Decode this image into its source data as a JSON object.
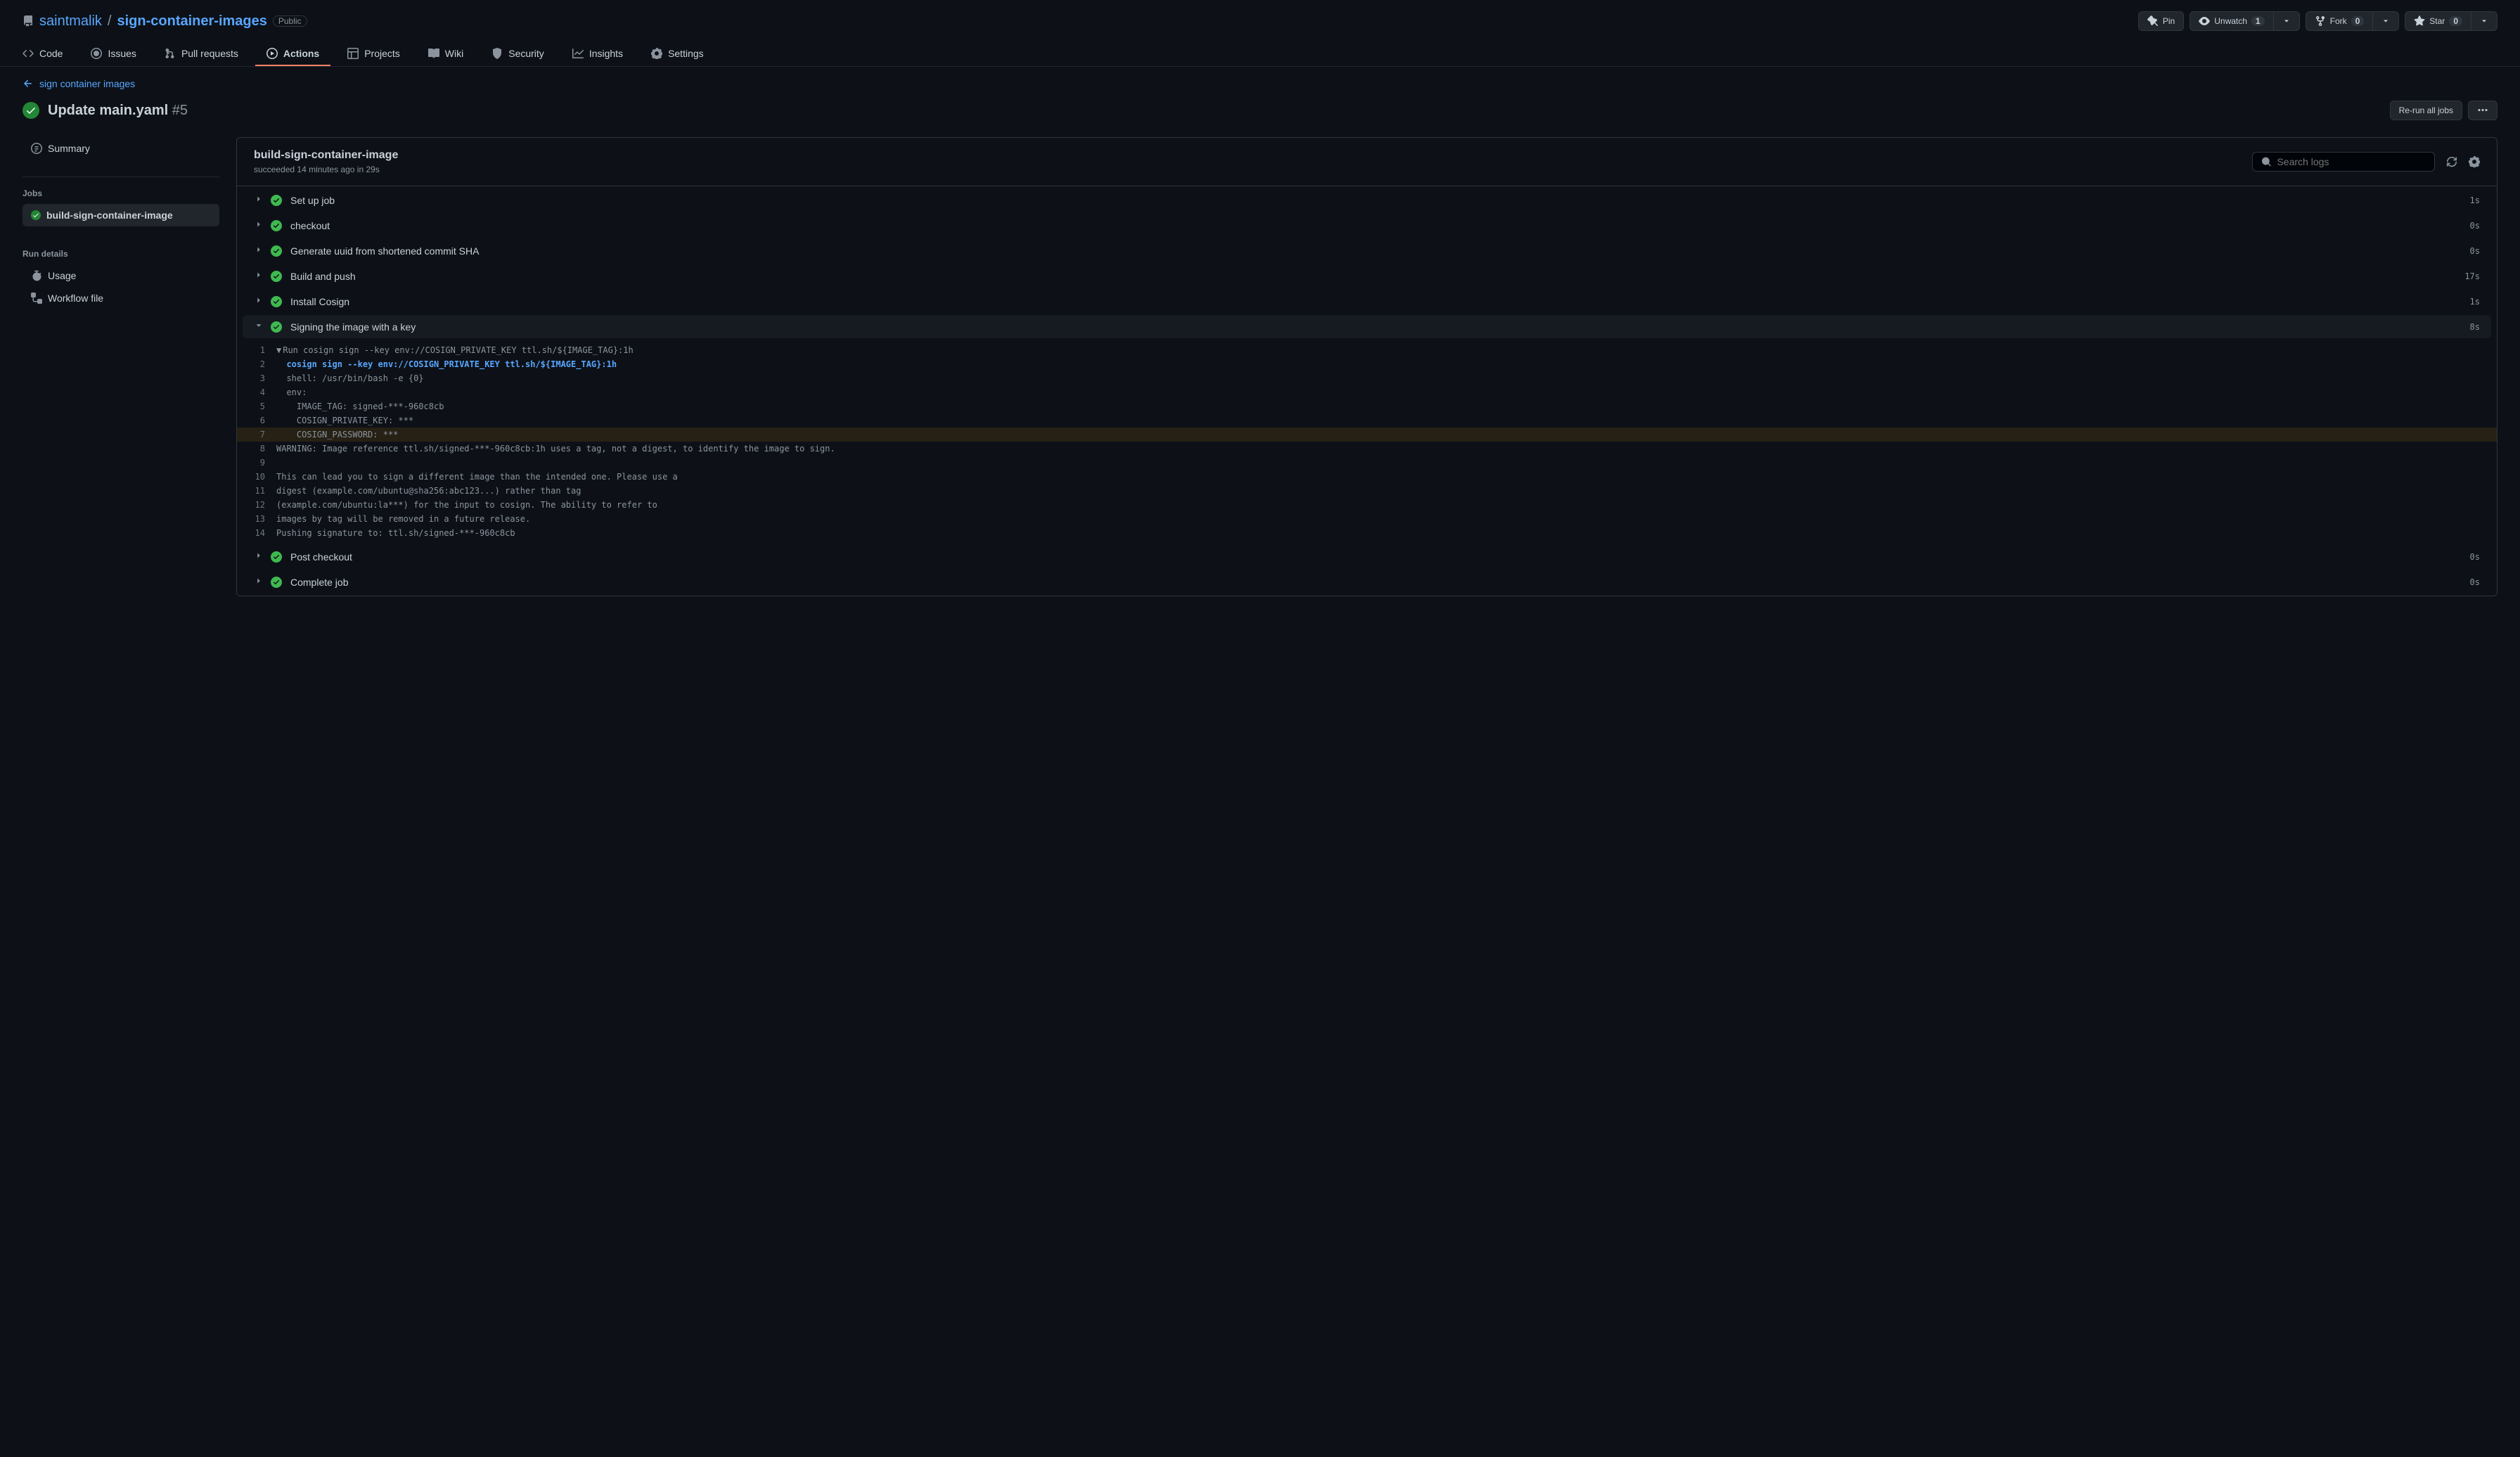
{
  "repo": {
    "owner": "saintmalik",
    "name": "sign-container-images",
    "visibility": "Public"
  },
  "actions": {
    "pin": {
      "label": "Pin"
    },
    "watch": {
      "label": "Unwatch",
      "count": "1"
    },
    "fork": {
      "label": "Fork",
      "count": "0"
    },
    "star": {
      "label": "Star",
      "count": "0"
    }
  },
  "nav": {
    "code": "Code",
    "issues": "Issues",
    "pulls": "Pull requests",
    "actions": "Actions",
    "projects": "Projects",
    "wiki": "Wiki",
    "security": "Security",
    "insights": "Insights",
    "settings": "Settings"
  },
  "back_link": "sign container images",
  "workflow": {
    "title": "Update main.yaml",
    "run_number": "#5",
    "rerun_label": "Re-run all jobs"
  },
  "sidebar": {
    "summary": "Summary",
    "jobs_heading": "Jobs",
    "job_name": "build-sign-container-image",
    "run_details_heading": "Run details",
    "usage": "Usage",
    "workflow_file": "Workflow file"
  },
  "job": {
    "title": "build-sign-container-image",
    "status": "succeeded",
    "time_ago": "14 minutes ago",
    "in_word": "in",
    "duration": "29s",
    "search_placeholder": "Search logs"
  },
  "steps": [
    {
      "name": "Set up job",
      "time": "1s",
      "expanded": false
    },
    {
      "name": "checkout",
      "time": "0s",
      "expanded": false
    },
    {
      "name": "Generate uuid from shortened commit SHA",
      "time": "0s",
      "expanded": false
    },
    {
      "name": "Build and push",
      "time": "17s",
      "expanded": false
    },
    {
      "name": "Install Cosign",
      "time": "1s",
      "expanded": false
    },
    {
      "name": "Signing the image with a key",
      "time": "8s",
      "expanded": true
    },
    {
      "name": "Post checkout",
      "time": "0s",
      "expanded": false
    },
    {
      "name": "Complete job",
      "time": "0s",
      "expanded": false
    }
  ],
  "logs": [
    {
      "n": "1",
      "caret": "▼",
      "text": "Run cosign sign --key env://COSIGN_PRIVATE_KEY ttl.sh/${IMAGE_TAG}:1h",
      "bold": false,
      "hl": false
    },
    {
      "n": "2",
      "caret": "",
      "text": "  cosign sign --key env://COSIGN_PRIVATE_KEY ttl.sh/${IMAGE_TAG}:1h",
      "bold": true,
      "hl": false
    },
    {
      "n": "3",
      "caret": "",
      "text": "  shell: /usr/bin/bash -e {0}",
      "bold": false,
      "hl": false
    },
    {
      "n": "4",
      "caret": "",
      "text": "  env:",
      "bold": false,
      "hl": false
    },
    {
      "n": "5",
      "caret": "",
      "text": "    IMAGE_TAG: signed-***-960c8cb",
      "bold": false,
      "hl": false
    },
    {
      "n": "6",
      "caret": "",
      "text": "    COSIGN_PRIVATE_KEY: ***",
      "bold": false,
      "hl": false
    },
    {
      "n": "7",
      "caret": "",
      "text": "    COSIGN_PASSWORD: ***",
      "bold": false,
      "hl": true
    },
    {
      "n": "8",
      "caret": "",
      "text": "WARNING: Image reference ttl.sh/signed-***-960c8cb:1h uses a tag, not a digest, to identify the image to sign.",
      "bold": false,
      "hl": false
    },
    {
      "n": "9",
      "caret": "",
      "text": "",
      "bold": false,
      "hl": false
    },
    {
      "n": "10",
      "caret": "",
      "text": "This can lead you to sign a different image than the intended one. Please use a ",
      "bold": false,
      "hl": false
    },
    {
      "n": "11",
      "caret": "",
      "text": "digest (example.com/ubuntu@sha256:abc123...) rather than tag ",
      "bold": false,
      "hl": false
    },
    {
      "n": "12",
      "caret": "",
      "text": "(example.com/ubuntu:la***) for the input to cosign. The ability to refer to ",
      "bold": false,
      "hl": false
    },
    {
      "n": "13",
      "caret": "",
      "text": "images by tag will be removed in a future release.",
      "bold": false,
      "hl": false
    },
    {
      "n": "14",
      "caret": "",
      "text": "Pushing signature to: ttl.sh/signed-***-960c8cb",
      "bold": false,
      "hl": false
    }
  ]
}
